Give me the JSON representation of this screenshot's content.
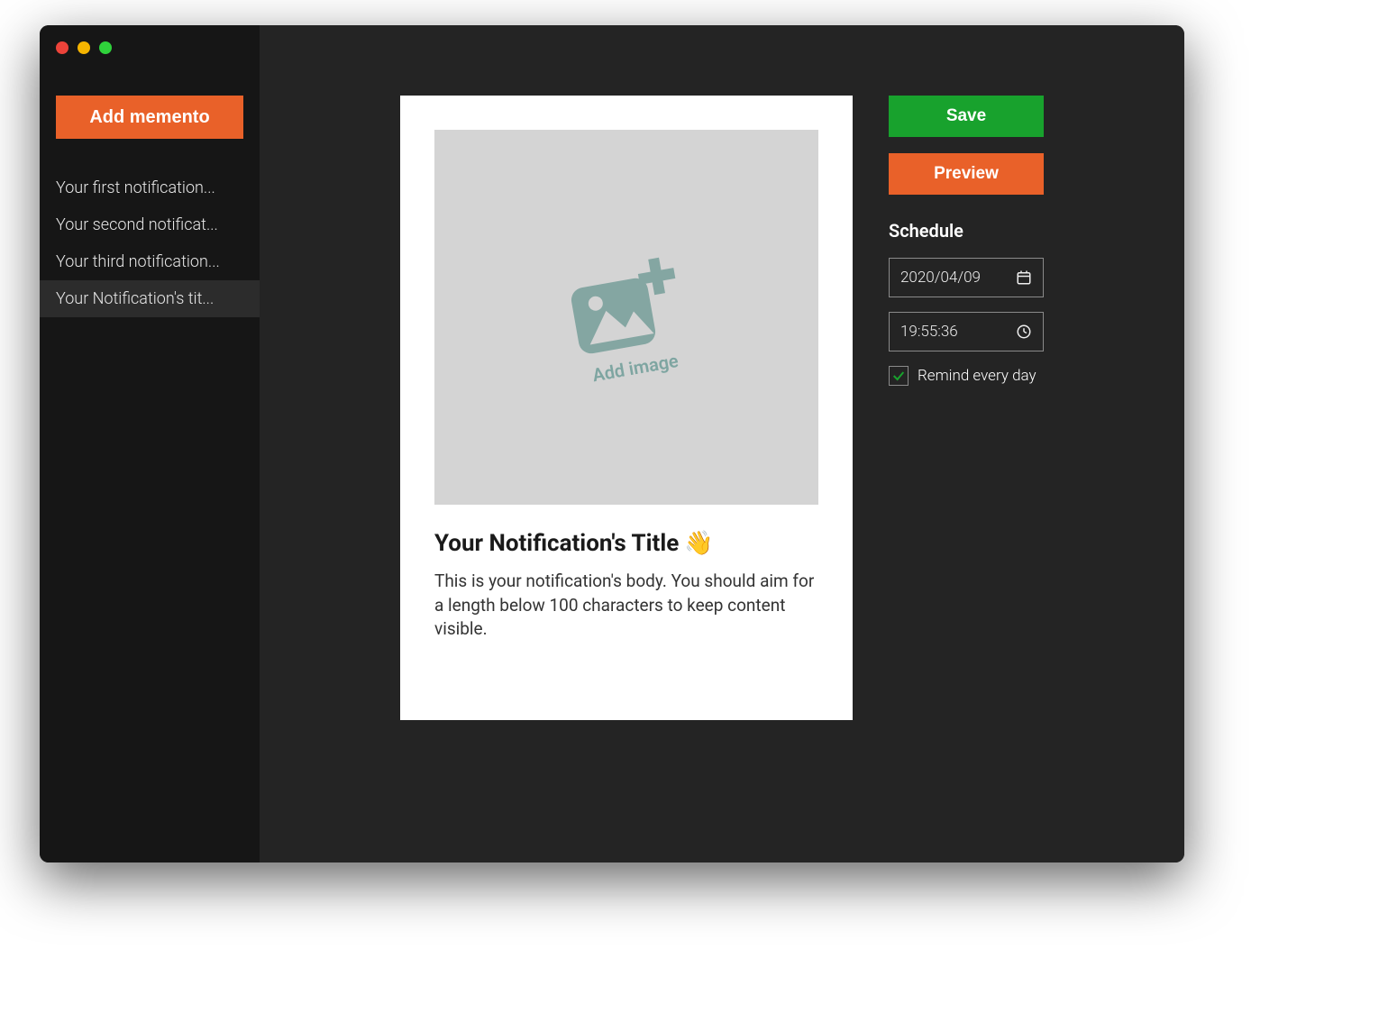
{
  "sidebar": {
    "add_label": "Add memento",
    "items": [
      {
        "label": "Your first notification..."
      },
      {
        "label": "Your second notificat..."
      },
      {
        "label": "Your third notification..."
      },
      {
        "label": "Your Notification's tit..."
      }
    ],
    "selected_index": 3
  },
  "editor": {
    "image_placeholder_label": "Add image",
    "title": "Your Notification's Title",
    "title_emoji": "👋",
    "body": "This is your notification's body. You should aim for a length below 100 characters to keep content visible."
  },
  "actions": {
    "save_label": "Save",
    "preview_label": "Preview"
  },
  "schedule": {
    "heading": "Schedule",
    "date": "2020/04/09",
    "time": "19:55:36",
    "repeat_label": "Remind every day",
    "repeat_checked": true
  },
  "colors": {
    "accent_orange": "#e96129",
    "accent_green": "#18a22d",
    "bg_dark": "#1e1e1e"
  }
}
